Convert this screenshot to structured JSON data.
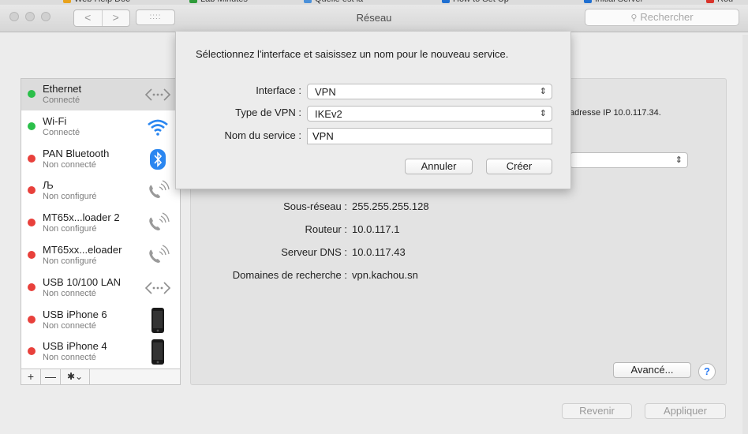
{
  "browser_tabs": [
    {
      "label": "Web Help Doc",
      "color": "#e8a21c"
    },
    {
      "label": "Lab Minutes",
      "color": "#2f9b3a"
    },
    {
      "label": "Quelle est la",
      "color": "#4a90d9"
    },
    {
      "label": "How to Set Up",
      "color": "#1f6fd1"
    },
    {
      "label": "Initial Server",
      "color": "#1f6fd1"
    },
    {
      "label": "Rou",
      "color": "#d9342b"
    }
  ],
  "window": {
    "title": "Réseau",
    "search_placeholder": "Rechercher",
    "back_glyph": "<",
    "forward_glyph": ">",
    "grid_glyph": "::::"
  },
  "sidebar": {
    "items": [
      {
        "name": "Ethernet",
        "status": "Connecté",
        "dot": "#2bbf4a",
        "icon": "arrows-icon",
        "selected": true
      },
      {
        "name": "Wi-Fi",
        "status": "Connecté",
        "dot": "#2bbf4a",
        "icon": "wifi-icon",
        "selected": false
      },
      {
        "name": "PAN Bluetooth",
        "status": "Non connecté",
        "dot": "#e8403b",
        "icon": "bluetooth-icon",
        "selected": false
      },
      {
        "name": "Љ",
        "status": "Non configuré",
        "dot": "#e8403b",
        "icon": "phone-icon",
        "selected": false
      },
      {
        "name": "MT65x...loader 2",
        "status": "Non configuré",
        "dot": "#e8403b",
        "icon": "phone-icon",
        "selected": false
      },
      {
        "name": "MT65xx...eloader",
        "status": "Non configuré",
        "dot": "#e8403b",
        "icon": "phone-icon",
        "selected": false
      },
      {
        "name": "USB 10/100 LAN",
        "status": "Non connecté",
        "dot": "#e8403b",
        "icon": "arrows-icon",
        "selected": false
      },
      {
        "name": "USB iPhone 6",
        "status": "Non connecté",
        "dot": "#e8403b",
        "icon": "iphone-icon",
        "selected": false
      },
      {
        "name": "USB iPhone 4",
        "status": "Non connecté",
        "dot": "#e8403b",
        "icon": "iphone-icon",
        "selected": false
      }
    ],
    "add_glyph": "+",
    "remove_glyph": "—",
    "gear_glyph": "✱⌄"
  },
  "main": {
    "status_text": "adresse IP 10.0.117.34.",
    "details": [
      {
        "label": "Sous-réseau :",
        "value": "255.255.255.128"
      },
      {
        "label": "Routeur :",
        "value": "10.0.117.1"
      },
      {
        "label": "Serveur DNS :",
        "value": "10.0.117.43"
      },
      {
        "label": "Domaines de recherche :",
        "value": "vpn.kachou.sn"
      }
    ],
    "advanced_label": "Avancé...",
    "help_glyph": "?",
    "revert_label": "Revenir",
    "apply_label": "Appliquer"
  },
  "sheet": {
    "prompt": "Sélectionnez l'interface et saisissez un nom pour le nouveau service.",
    "interface_label": "Interface :",
    "interface_value": "VPN",
    "vpn_type_label": "Type de VPN :",
    "vpn_type_value": "IKEv2",
    "service_name_label": "Nom du service :",
    "service_name_value": "VPN",
    "cancel_label": "Annuler",
    "create_label": "Créer"
  }
}
